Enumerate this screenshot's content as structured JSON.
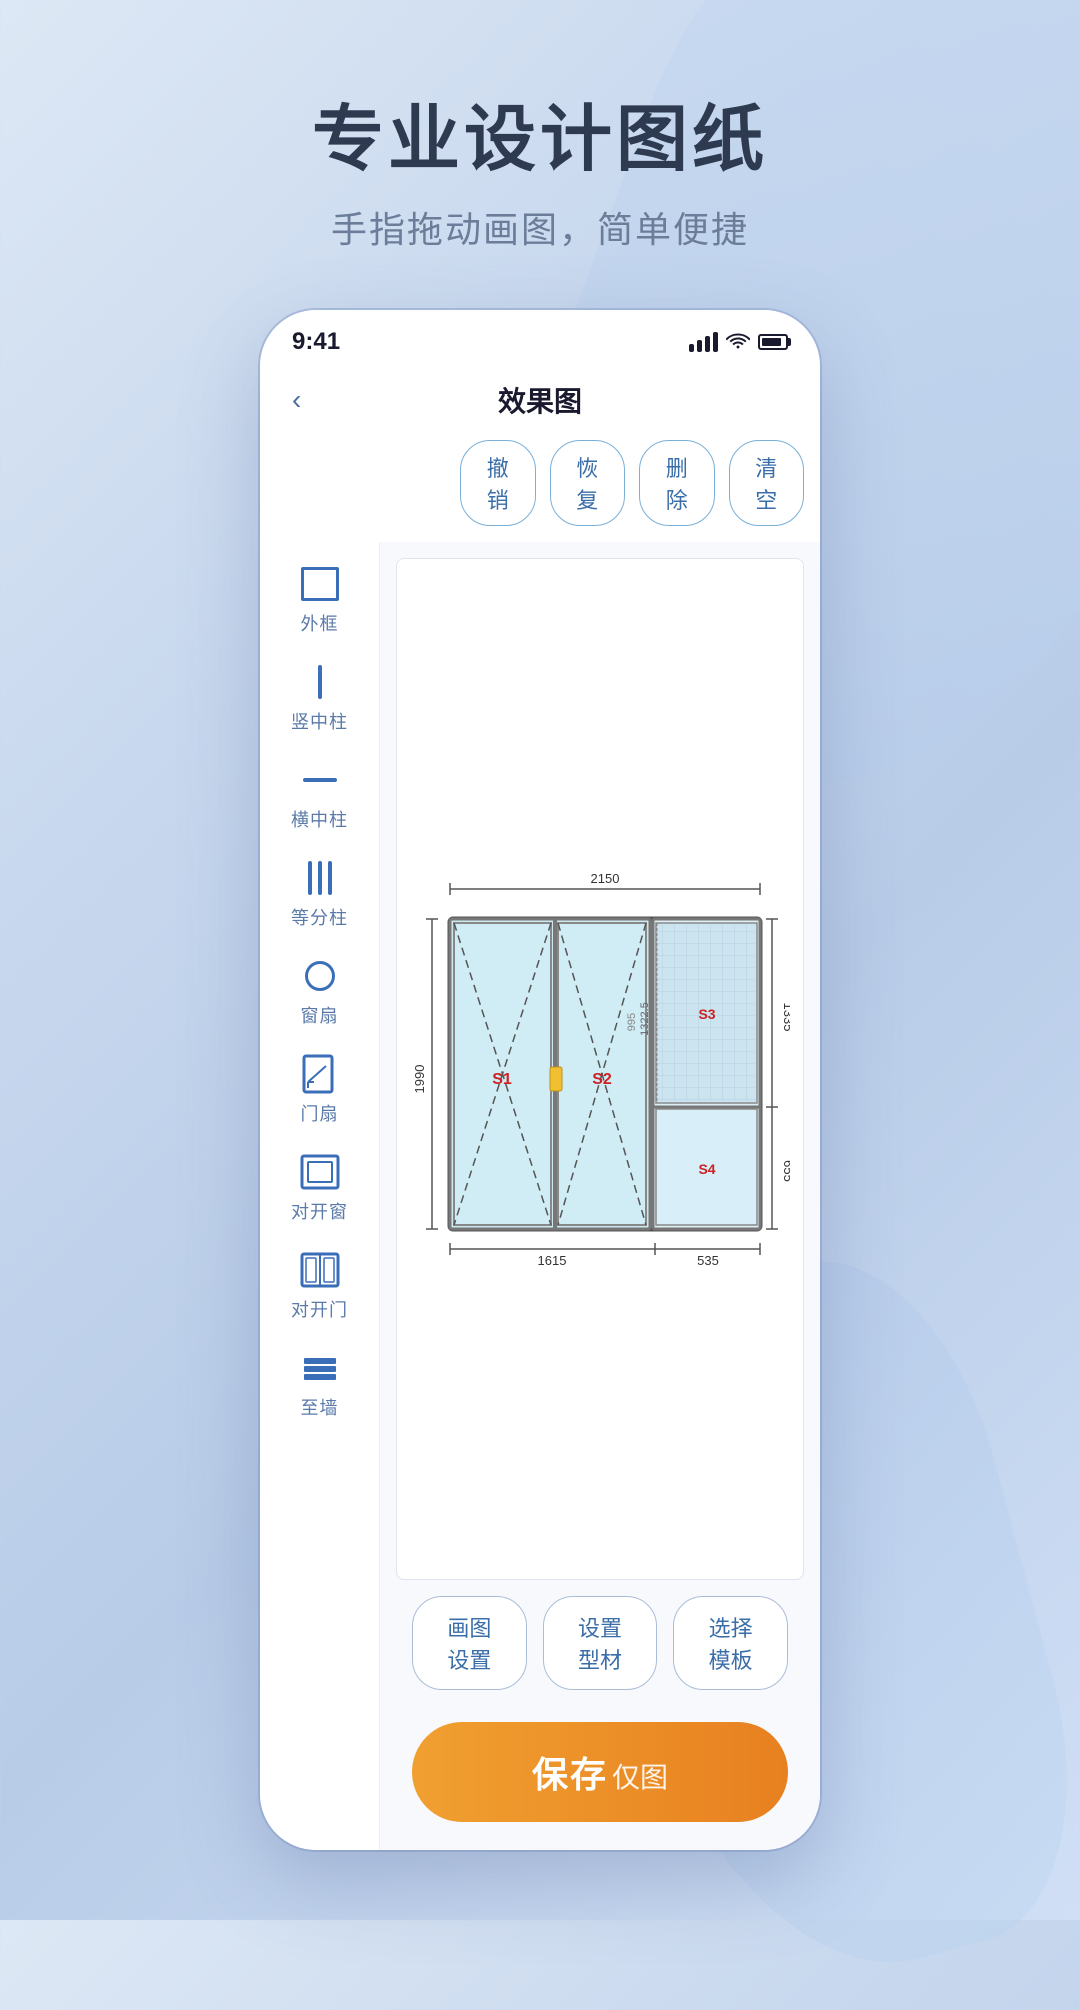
{
  "background": {
    "gradient_start": "#dde8f5",
    "gradient_end": "#b8cce8"
  },
  "title_section": {
    "main_title": "专业设计图纸",
    "sub_title": "手指拖动画图，简单便捷"
  },
  "phone": {
    "status_bar": {
      "time": "9:41",
      "signal_label": "signal",
      "wifi_label": "wifi",
      "battery_label": "battery"
    },
    "nav": {
      "back_icon": "‹",
      "title": "效果图"
    },
    "toolbar_buttons": [
      {
        "label": "撤销",
        "id": "undo"
      },
      {
        "label": "恢复",
        "id": "redo"
      },
      {
        "label": "删除",
        "id": "delete"
      },
      {
        "label": "清空",
        "id": "clear"
      }
    ],
    "sidebar_items": [
      {
        "id": "outer-frame",
        "label": "外框",
        "icon_type": "outer-frame"
      },
      {
        "id": "vert-pillar",
        "label": "竖中柱",
        "icon_type": "vert-pillar"
      },
      {
        "id": "horiz-pillar",
        "label": "横中柱",
        "icon_type": "horiz-pillar"
      },
      {
        "id": "equal-pillars",
        "label": "等分柱",
        "icon_type": "equal-pillars"
      },
      {
        "id": "window-sash",
        "label": "窗扇",
        "icon_type": "window-sash"
      },
      {
        "id": "door-sash",
        "label": "门扇",
        "icon_type": "door-sash"
      },
      {
        "id": "casement-window",
        "label": "对开窗",
        "icon_type": "casement-window"
      },
      {
        "id": "casement-door",
        "label": "对开门",
        "icon_type": "casement-door"
      },
      {
        "id": "wall",
        "label": "至墙",
        "icon_type": "wall"
      }
    ],
    "drawing": {
      "dimension_top": "2150",
      "dimension_left": "1990",
      "dimension_right_top": "1335",
      "dimension_right_bottom": "655",
      "dimension_bottom_left": "1615",
      "dimension_bottom_right": "535",
      "inner_dim_1": "995",
      "inner_dim_2": "1322.5",
      "label_s1": "S1",
      "label_s2": "S2",
      "label_s3": "S3",
      "label_s4": "S4"
    },
    "bottom_toolbar": [
      {
        "label": "画图设置",
        "id": "drawing-settings"
      },
      {
        "label": "设置型材",
        "id": "material-settings"
      },
      {
        "label": "选择模板",
        "id": "select-template"
      }
    ],
    "save_button": {
      "bold_text": "保存",
      "normal_text": "仅图"
    }
  }
}
